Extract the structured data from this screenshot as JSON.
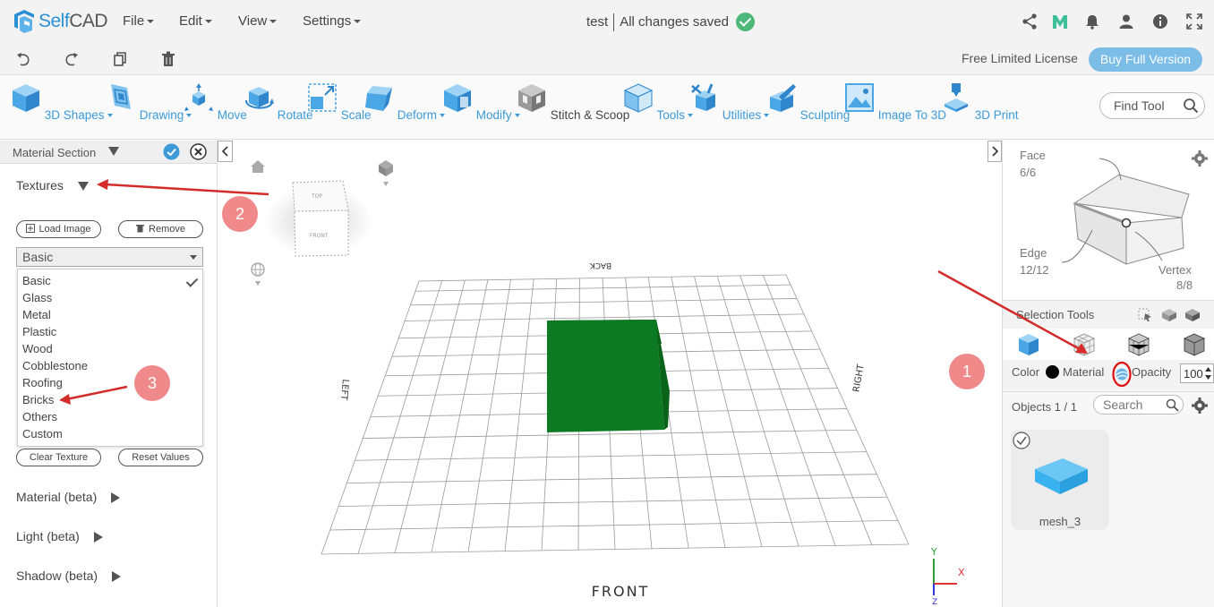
{
  "app": {
    "name_left": "Self",
    "name_right": "CAD"
  },
  "menu": {
    "file": "File",
    "edit": "Edit",
    "view": "View",
    "settings": "Settings"
  },
  "document": {
    "title": "test",
    "status": "All changes saved"
  },
  "license": {
    "text": "Free Limited License",
    "buy_label": "Buy Full Version"
  },
  "toolbar": {
    "tools": [
      "3D Shapes",
      "Drawing",
      "Move",
      "Rotate",
      "Scale",
      "Deform",
      "Modify",
      "Stitch & Scoop",
      "Tools",
      "Utilities",
      "Sculpting",
      "Image To 3D",
      "3D Print"
    ],
    "find_placeholder": "Find Tool"
  },
  "left_panel": {
    "header": "Material Section",
    "textures_label": "Textures",
    "load_image": "Load Image",
    "remove": "Remove",
    "selected_texture": "Basic",
    "texture_options": [
      "Basic",
      "Glass",
      "Metal",
      "Plastic",
      "Wood",
      "Cobblestone",
      "Roofing",
      "Bricks",
      "Others",
      "Custom"
    ],
    "clear_texture": "Clear Texture",
    "reset_values": "Reset Values",
    "material_beta": "Material (beta)",
    "light_beta": "Light (beta)",
    "shadow_beta": "Shadow (beta)"
  },
  "viewport": {
    "cube_top": "TOP",
    "cube_front": "FRONT",
    "label_front": "FRONT",
    "label_back": "BACK",
    "label_left": "LEFT",
    "label_right": "RIGHT",
    "axis_y": "Y",
    "axis_x": "X",
    "axis_z": "Z",
    "object_color": "#0c7a22"
  },
  "right_panel": {
    "face_label": "Face",
    "face_count": "6/6",
    "edge_label": "Edge",
    "edge_count": "12/12",
    "vertex_label": "Vertex",
    "vertex_count": "8/8",
    "selection_tools": "Selection Tools",
    "color_label": "Color",
    "material_label": "Material",
    "opacity_label": "Opacity",
    "opacity_value": "100",
    "objects_label": "Objects 1 / 1",
    "search_placeholder": "Search",
    "object_name": "mesh_3"
  },
  "annotations": {
    "badge1": "1",
    "badge2": "2",
    "badge3": "3"
  }
}
